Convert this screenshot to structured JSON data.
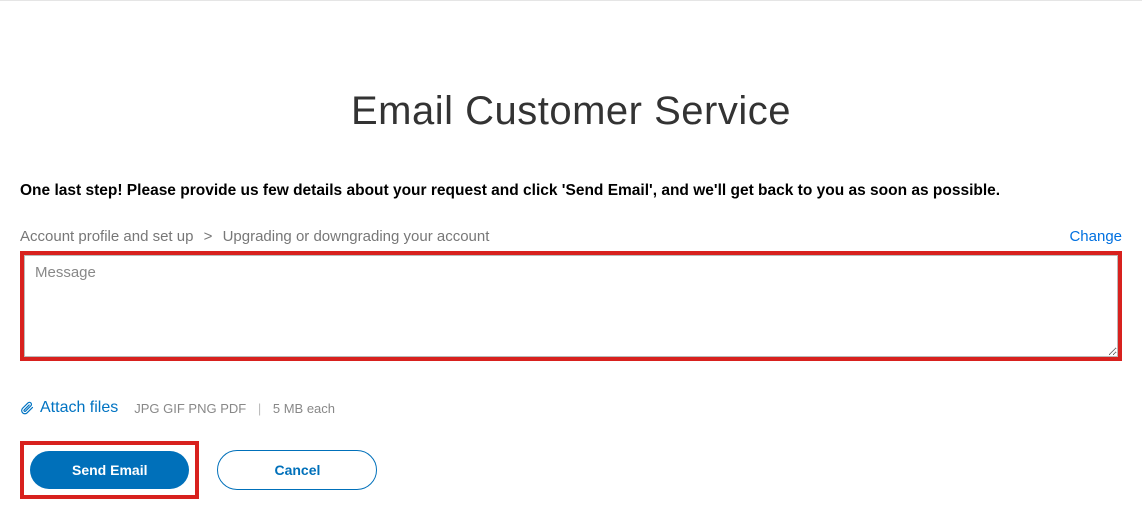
{
  "title": "Email Customer Service",
  "instruction": "One last step! Please provide us few details about your request and click 'Send Email', and we'll get back to you as soon as possible.",
  "breadcrumb": {
    "level1": "Account profile and set up",
    "separator": ">",
    "level2": "Upgrading or downgrading your account",
    "change_label": "Change"
  },
  "message": {
    "placeholder": "Message",
    "value": ""
  },
  "attach": {
    "label": "Attach files",
    "hint_formats": "JPG GIF PNG PDF",
    "hint_divider": "|",
    "hint_size": "5 MB each"
  },
  "buttons": {
    "send": "Send Email",
    "cancel": "Cancel"
  }
}
